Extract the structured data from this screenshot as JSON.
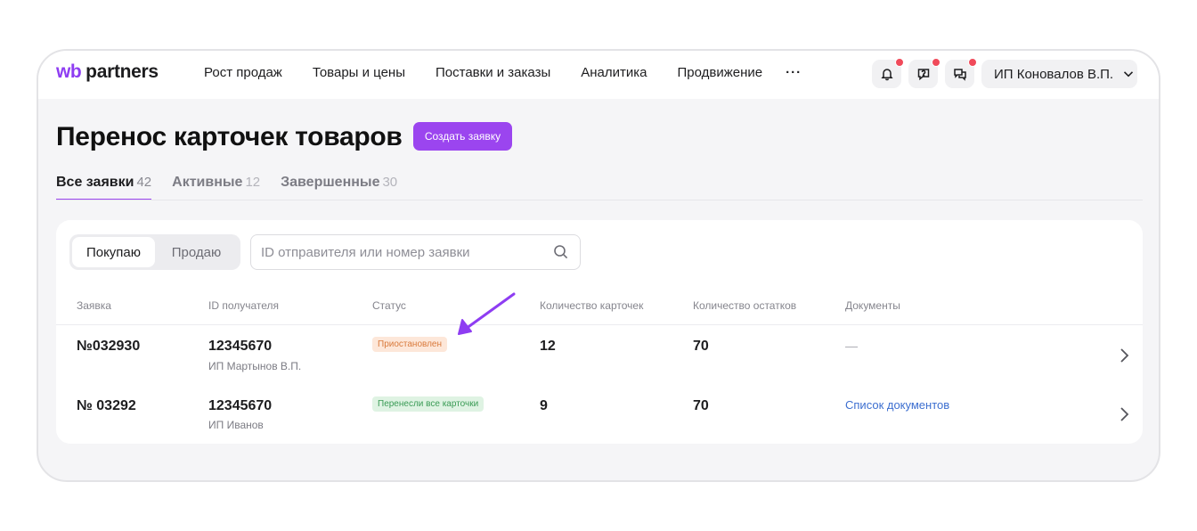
{
  "header": {
    "logo_wb": "wb",
    "logo_partners": "partners",
    "nav": [
      "Рост продаж",
      "Товары и цены",
      "Поставки и заказы",
      "Аналитика",
      "Продвижение"
    ],
    "more": "···",
    "user": "ИП Коновалов В.П.",
    "icons": [
      "bell-icon",
      "help-chat-icon",
      "messages-icon"
    ],
    "accent_color": "#9b45ef",
    "notification_color": "#f04a5a"
  },
  "page": {
    "title": "Перенос карточек товаров",
    "create_button": "Создать заявку",
    "tabs": [
      {
        "label": "Все заявки",
        "count": "42"
      },
      {
        "label": "Активные",
        "count": "12"
      },
      {
        "label": "Завершенные",
        "count": "30"
      }
    ]
  },
  "filters": {
    "segments": [
      "Покупаю",
      "Продаю"
    ],
    "search_placeholder": "ID отправителя или номер заявки"
  },
  "table": {
    "headers": [
      "Заявка",
      "ID получателя",
      "Статус",
      "Количество карточек",
      "Количество остатков",
      "Документы"
    ],
    "rows": [
      {
        "id": "№032930",
        "recipient_id": "12345670",
        "recipient_name": "ИП Мартынов В.П.",
        "status": "Приостановлен",
        "cards": "12",
        "stock": "70",
        "documents": "—"
      },
      {
        "id": "№ 03292",
        "recipient_id": "12345670",
        "recipient_name": "ИП Иванов",
        "status": "Перенесли все карточки",
        "cards": "9",
        "stock": "70",
        "documents": "Список документов"
      }
    ]
  }
}
